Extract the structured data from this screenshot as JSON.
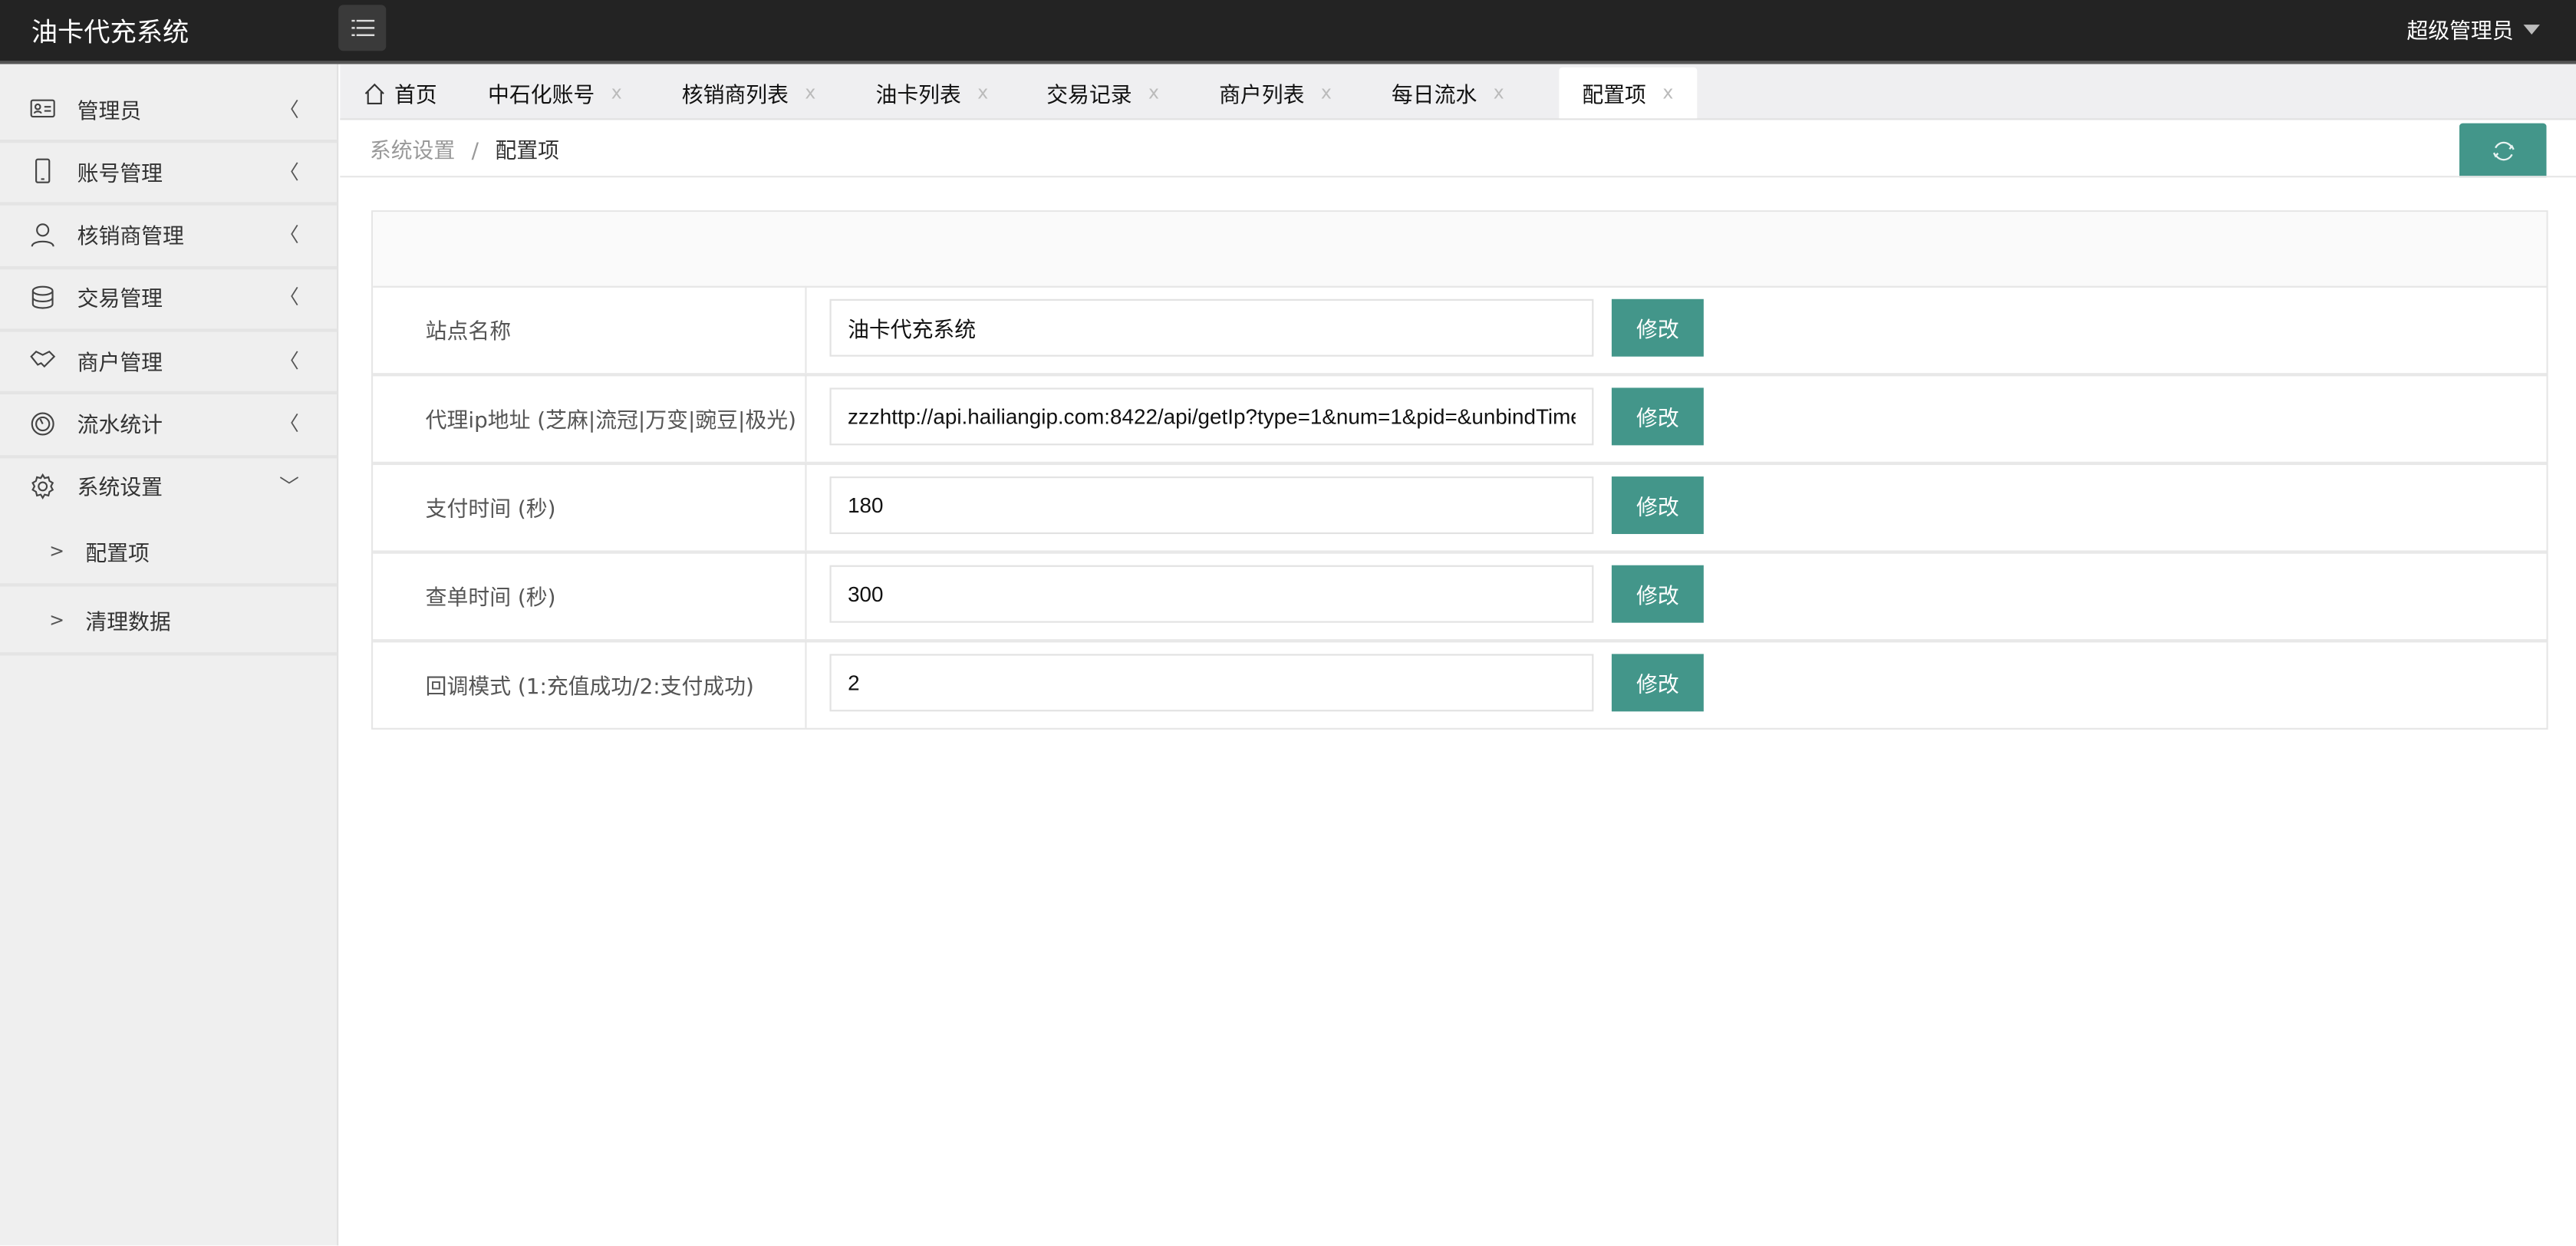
{
  "header": {
    "title": "油卡代充系统",
    "user": "超级管理员"
  },
  "sidebar": {
    "items": [
      {
        "label": "管理员",
        "icon": "id-card-icon"
      },
      {
        "label": "账号管理",
        "icon": "phone-icon"
      },
      {
        "label": "核销商管理",
        "icon": "user-icon"
      },
      {
        "label": "交易管理",
        "icon": "database-icon"
      },
      {
        "label": "商户管理",
        "icon": "handshake-icon"
      },
      {
        "label": "流水统计",
        "icon": "dashboard-icon"
      },
      {
        "label": "系统设置",
        "icon": "gear-icon",
        "expanded": true
      }
    ],
    "sub_items": [
      {
        "label": "配置项"
      },
      {
        "label": "清理数据"
      }
    ]
  },
  "tabs": [
    {
      "label": "首页",
      "closable": false
    },
    {
      "label": "中石化账号"
    },
    {
      "label": "核销商列表"
    },
    {
      "label": "油卡列表"
    },
    {
      "label": "交易记录"
    },
    {
      "label": "商户列表"
    },
    {
      "label": "每日流水"
    },
    {
      "label": "配置项",
      "active": true
    }
  ],
  "tab_close": "x",
  "breadcrumb": {
    "parent": "系统设置",
    "sep": "/",
    "current": "配置项"
  },
  "config": {
    "edit_label": "修改",
    "rows": [
      {
        "label": "站点名称",
        "value": "油卡代充系统"
      },
      {
        "label": "代理ip地址 (芝麻|流冠|万变|豌豆|极光)",
        "value": "zzzhttp://api.hailiangip.com:8422/api/getIp?type=1&num=1&pid=&unbindTime"
      },
      {
        "label": "支付时间 (秒)",
        "value": "180"
      },
      {
        "label": "查单时间 (秒)",
        "value": "300"
      },
      {
        "label": "回调模式 (1:充值成功/2:支付成功)",
        "value": "2"
      }
    ]
  },
  "colors": {
    "accent": "#43968a",
    "header_bg": "#232323",
    "sidebar_bg": "#efefef"
  }
}
